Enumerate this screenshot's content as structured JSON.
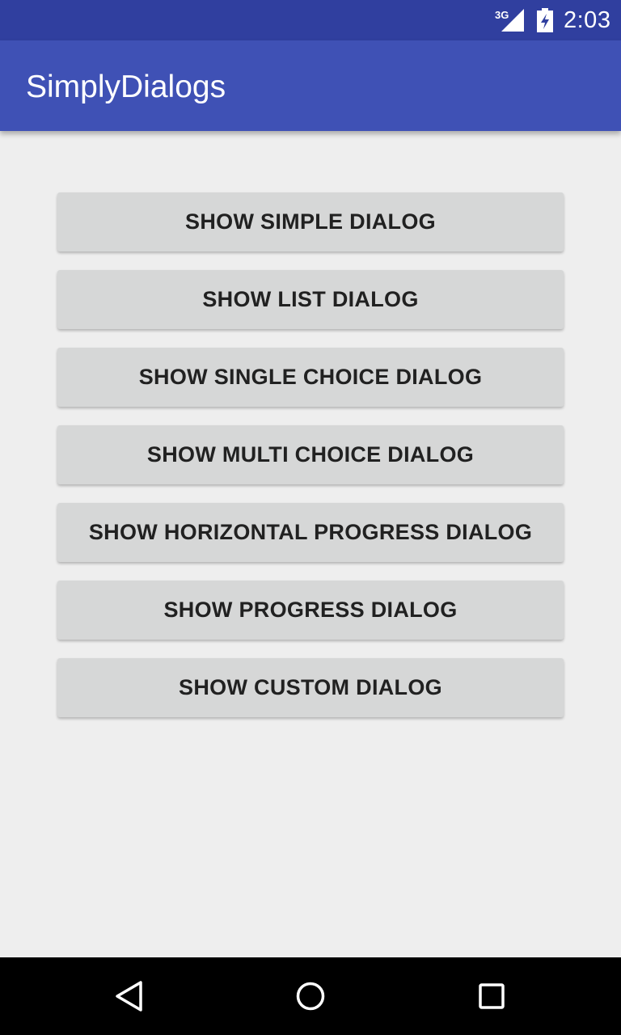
{
  "status_bar": {
    "network": "3G",
    "time": "2:03",
    "icons": [
      "signal-icon",
      "battery-charging-icon"
    ]
  },
  "app_bar": {
    "title": "SimplyDialogs"
  },
  "buttons": [
    {
      "label": "SHOW SIMPLE DIALOG"
    },
    {
      "label": "SHOW LIST DIALOG"
    },
    {
      "label": "SHOW SINGLE CHOICE DIALOG"
    },
    {
      "label": "SHOW MULTI CHOICE DIALOG"
    },
    {
      "label": "SHOW HORIZONTAL PROGRESS DIALOG"
    },
    {
      "label": "SHOW PROGRESS DIALOG"
    },
    {
      "label": "SHOW CUSTOM DIALOG"
    }
  ],
  "nav_bar": {
    "icons": [
      "back-icon",
      "home-icon",
      "recents-icon"
    ]
  },
  "colors": {
    "status_bar": "#303f9f",
    "app_bar": "#3f51b5",
    "background": "#eeeeee",
    "button": "#d6d7d7",
    "button_text": "#212121",
    "nav_bar": "#000000"
  }
}
